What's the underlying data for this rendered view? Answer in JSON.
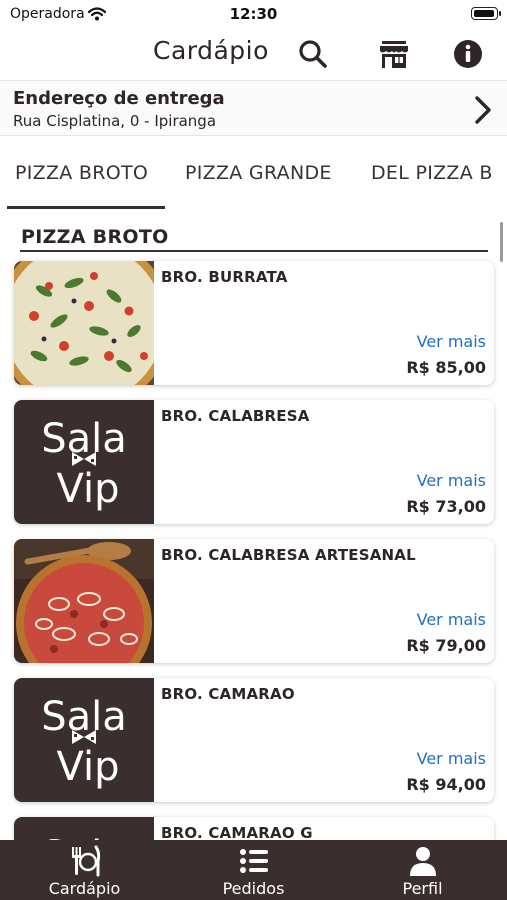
{
  "status_bar": {
    "carrier": "Operadora",
    "time": "12:30"
  },
  "header": {
    "title": "Cardápio",
    "icons": [
      "search-icon",
      "store-icon",
      "info-icon"
    ]
  },
  "address": {
    "title": "Endereço de entrega",
    "line": "Rua Cisplatina, 0  - Ipiranga"
  },
  "tabs": [
    {
      "label": "PIZZA BROTO",
      "selected": true
    },
    {
      "label": "PIZZA GRANDE",
      "selected": false
    },
    {
      "label": "DEL PIZZA B",
      "selected": false
    }
  ],
  "section": {
    "title": "PIZZA BROTO"
  },
  "products": [
    {
      "name": "BRO. BURRATA",
      "more": "Ver mais",
      "price": "R$ 85,00",
      "image": "pizza-burrata-photo"
    },
    {
      "name": "BRO. CALABRESA",
      "more": "Ver mais",
      "price": "R$ 73,00",
      "image": "sala-vip-logo"
    },
    {
      "name": "BRO. CALABRESA ARTESANAL",
      "more": "Ver mais",
      "price": "R$ 79,00",
      "image": "pizza-calabresa-photo"
    },
    {
      "name": "BRO. CAMARAO",
      "more": "Ver mais",
      "price": "R$ 94,00",
      "image": "sala-vip-logo"
    },
    {
      "name": "BRO. CAMARAO G",
      "more": "",
      "price": "",
      "image": "sala-vip-logo"
    }
  ],
  "logo": {
    "line1": "Sala",
    "line2": "Vip"
  },
  "bottom_nav": [
    {
      "label": "Cardápio",
      "icon": "cutlery-icon"
    },
    {
      "label": "Pedidos",
      "icon": "list-icon"
    },
    {
      "label": "Perfil",
      "icon": "user-icon"
    }
  ],
  "colors": {
    "brand": "#3a2e2e",
    "link": "#1f6fc4",
    "text": "#2e2626"
  }
}
